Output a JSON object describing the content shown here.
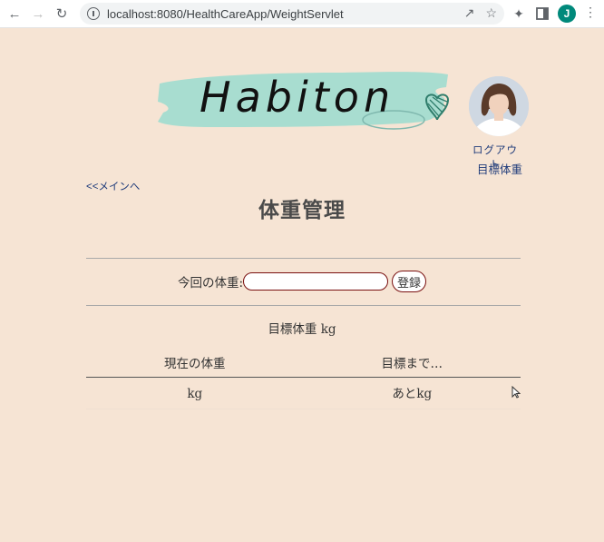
{
  "browser": {
    "url": "localhost:8080/HealthCareApp/WeightServlet",
    "profile_initial": "J"
  },
  "header": {
    "logo_text": "Habiton",
    "logout_label": "ログアウト",
    "target_weight_link": "目標体重"
  },
  "nav": {
    "back_label": "<<メインへ"
  },
  "page": {
    "title": "体重管理"
  },
  "form": {
    "weight_label": "今回の体重:",
    "weight_value": "",
    "register_label": "登録"
  },
  "goal": {
    "text": "目標体重 kg"
  },
  "table": {
    "headers": [
      "現在の体重",
      "目標まで…"
    ],
    "rows": [
      [
        "kg",
        "あとkg"
      ]
    ]
  },
  "colors": {
    "background": "#f6e4d4",
    "link": "#1f3b7a",
    "input_border": "#7a1010",
    "logo_brush": "#a8ddd0"
  }
}
